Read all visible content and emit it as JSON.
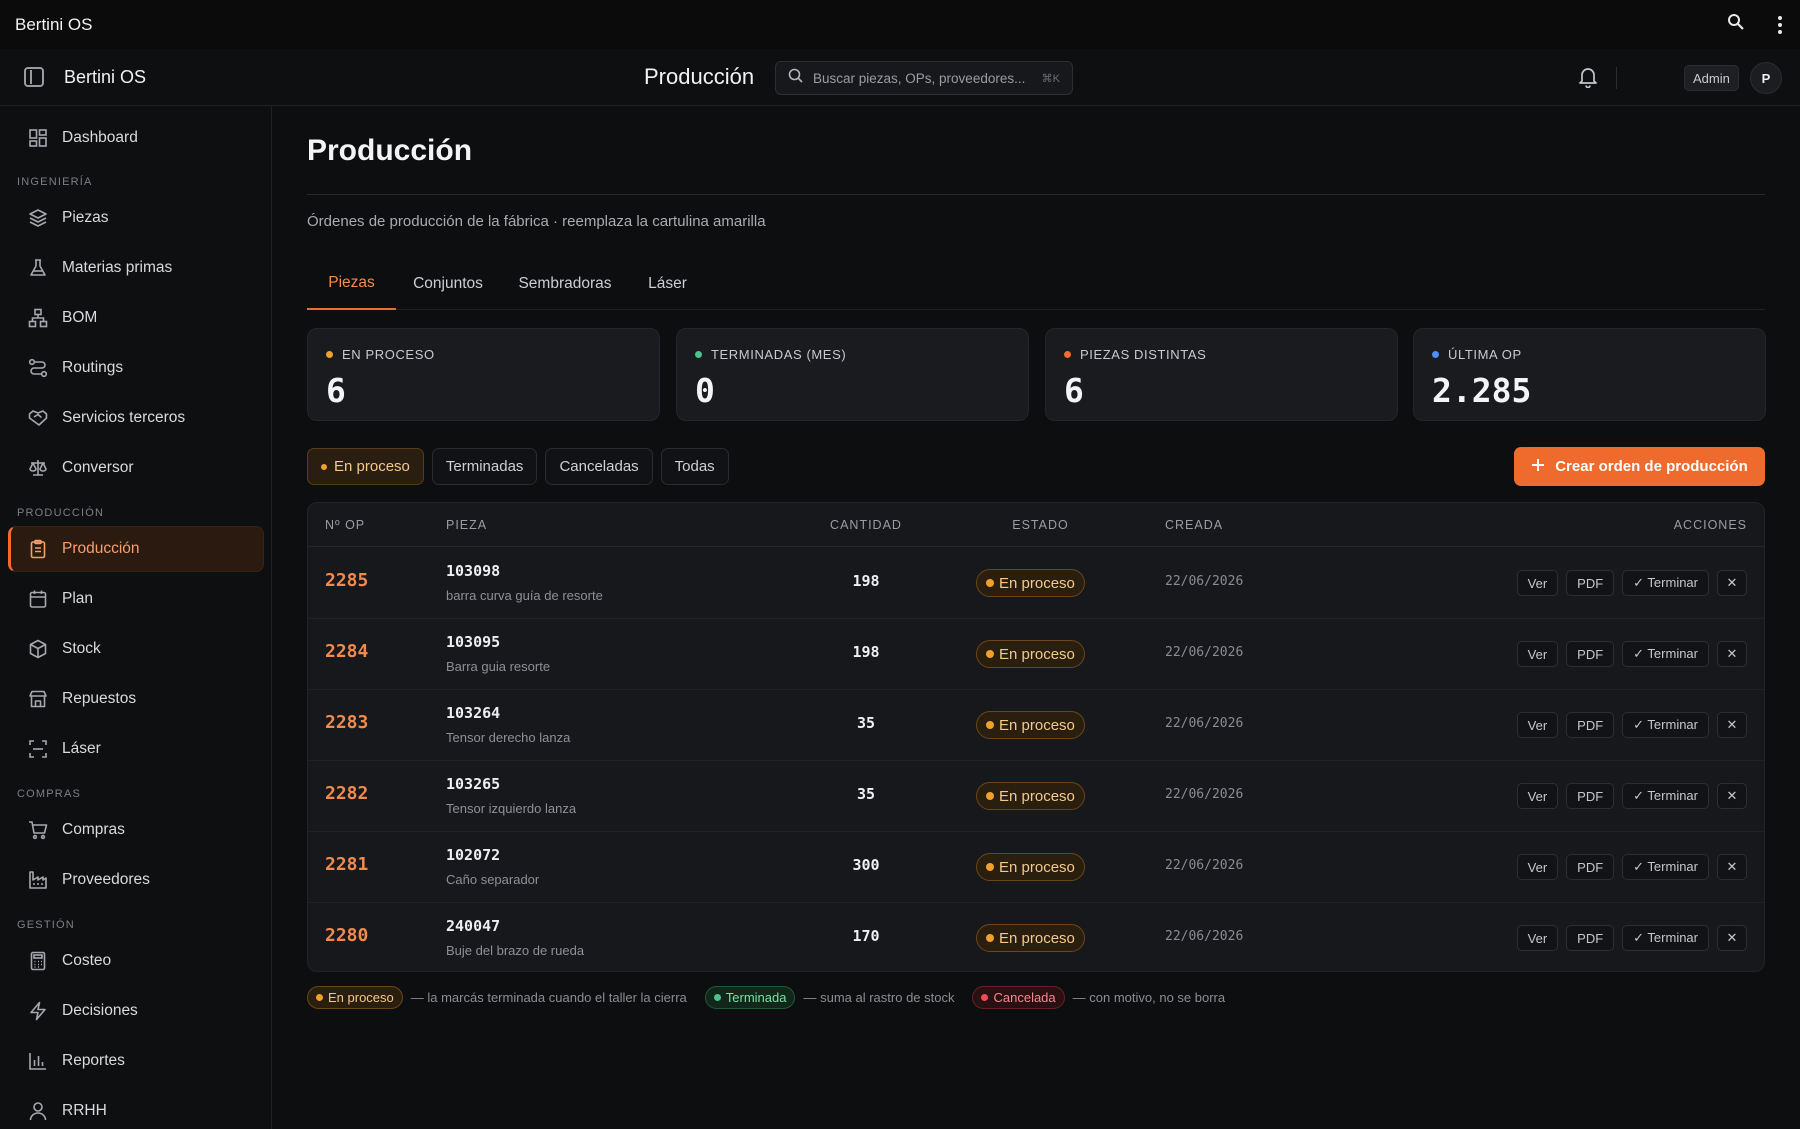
{
  "os": {
    "title": "Bertini OS"
  },
  "header": {
    "brand": "Bertini OS",
    "page_title": "Producción",
    "search_placeholder": "Buscar piezas, OPs, proveedores...",
    "search_shortcut": "⌘K",
    "role": "Admin",
    "avatar": "P"
  },
  "sidebar": {
    "top": [
      {
        "label": "Dashboard",
        "icon": "dashboard-icon"
      }
    ],
    "sections": [
      {
        "title": "INGENIERÍA",
        "items": [
          {
            "label": "Piezas",
            "icon": "layers-icon"
          },
          {
            "label": "Materias primas",
            "icon": "flask-icon"
          },
          {
            "label": "BOM",
            "icon": "hierarchy-icon"
          },
          {
            "label": "Routings",
            "icon": "route-icon"
          },
          {
            "label": "Servicios terceros",
            "icon": "handshake-icon"
          },
          {
            "label": "Conversor",
            "icon": "scale-icon"
          }
        ]
      },
      {
        "title": "PRODUCCIÓN",
        "items": [
          {
            "label": "Producción",
            "icon": "clipboard-icon",
            "active": true
          },
          {
            "label": "Plan",
            "icon": "calendar-icon"
          },
          {
            "label": "Stock",
            "icon": "box-icon"
          },
          {
            "label": "Repuestos",
            "icon": "store-icon"
          },
          {
            "label": "Láser",
            "icon": "scan-icon"
          }
        ]
      },
      {
        "title": "COMPRAS",
        "items": [
          {
            "label": "Compras",
            "icon": "cart-icon"
          },
          {
            "label": "Proveedores",
            "icon": "factory-icon"
          }
        ]
      },
      {
        "title": "GESTIÓN",
        "items": [
          {
            "label": "Costeo",
            "icon": "calculator-icon"
          },
          {
            "label": "Decisiones",
            "icon": "bolt-icon"
          },
          {
            "label": "Reportes",
            "icon": "bar-chart-icon"
          },
          {
            "label": "RRHH",
            "icon": "user-icon"
          }
        ]
      }
    ]
  },
  "main": {
    "title": "Producción",
    "subtitle": "Órdenes de producción de la fábrica · reemplaza la cartulina amarilla",
    "tabs": [
      "Piezas",
      "Conjuntos",
      "Sembradoras",
      "Láser"
    ],
    "active_tab": "Piezas",
    "stats": [
      {
        "label": "EN PROCESO",
        "value": "6",
        "color": "#f0a12b"
      },
      {
        "label": "TERMINADAS (MES)",
        "value": "0",
        "color": "#4cc38a"
      },
      {
        "label": "PIEZAS DISTINTAS",
        "value": "6",
        "color": "#f26b2d"
      },
      {
        "label": "ÚLTIMA OP",
        "value": "2.285",
        "color": "#4f8ff7"
      }
    ],
    "filters": [
      "En proceso",
      "Terminadas",
      "Canceladas",
      "Todas"
    ],
    "active_filter": "En proceso",
    "create_label": "Crear orden de producción",
    "table": {
      "headers": {
        "op": "Nº OP",
        "pieza": "PIEZA",
        "cantidad": "CANTIDAD",
        "estado": "ESTADO",
        "creada": "CREADA",
        "acciones": "ACCIONES"
      },
      "rows": [
        {
          "op": "2285",
          "code": "103098",
          "name": "barra curva guía de resorte",
          "qty": "198",
          "estado": "En proceso",
          "date": "22/06/2026"
        },
        {
          "op": "2284",
          "code": "103095",
          "name": "Barra guia resorte",
          "qty": "198",
          "estado": "En proceso",
          "date": "22/06/2026"
        },
        {
          "op": "2283",
          "code": "103264",
          "name": "Tensor derecho lanza",
          "qty": "35",
          "estado": "En proceso",
          "date": "22/06/2026"
        },
        {
          "op": "2282",
          "code": "103265",
          "name": "Tensor izquierdo lanza",
          "qty": "35",
          "estado": "En proceso",
          "date": "22/06/2026"
        },
        {
          "op": "2281",
          "code": "102072",
          "name": "Caño separador",
          "qty": "300",
          "estado": "En proceso",
          "date": "22/06/2026"
        },
        {
          "op": "2280",
          "code": "240047",
          "name": "Buje del brazo de rueda",
          "qty": "170",
          "estado": "En proceso",
          "date": "22/06/2026"
        }
      ],
      "actions": {
        "ver": "Ver",
        "pdf": "PDF",
        "terminar": "✓ Terminar",
        "cancel": "✕"
      }
    },
    "legend": [
      {
        "pill": "En proceso",
        "text": "— la marcás terminada cuando el taller la cierra",
        "color": "#f0a12b"
      },
      {
        "pill": "Terminada",
        "text": "— suma al rastro de stock",
        "color": "#4cc38a"
      },
      {
        "pill": "Cancelada",
        "text": "— con motivo, no se borra",
        "color": "#ef4b54"
      }
    ]
  }
}
